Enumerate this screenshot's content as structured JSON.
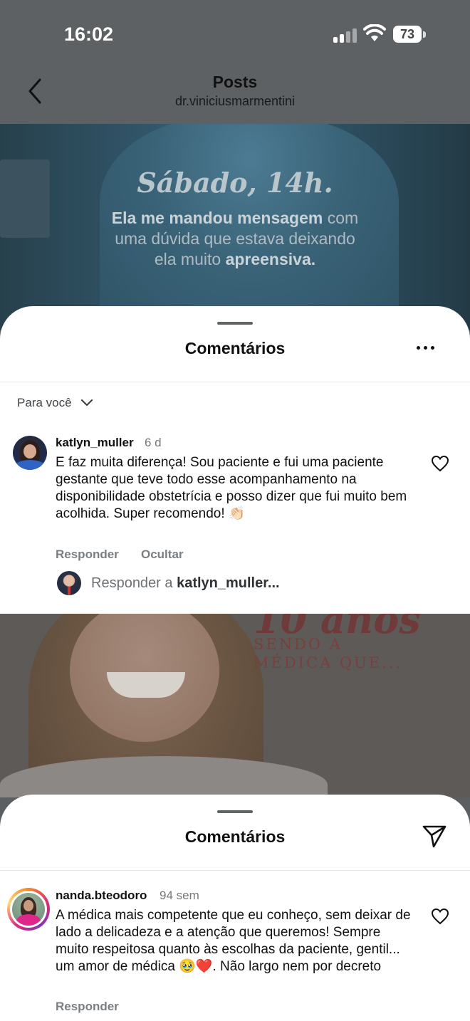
{
  "status_bar": {
    "time": "16:02",
    "battery": "73"
  },
  "header": {
    "title": "Posts",
    "username": "dr.viniciusmarmentini"
  },
  "post1_overlay": {
    "heading": "Sábado, 14h.",
    "line1_bold": "Ela me mandou mensagem",
    "line1_rest": " com",
    "line2": "uma dúvida que estava deixando",
    "line3_start": "ela muito ",
    "line3_bold": "apreensiva."
  },
  "sheet1": {
    "title": "Comentários",
    "filter": "Para você",
    "comment": {
      "username": "katlyn_muller",
      "time": "6 d",
      "text": "E faz muita diferença! Sou paciente e fui uma paciente gestante que teve todo esse acompanhamento na disponibilidade obstetrícia e posso dizer que fui muito bem acolhida. Super recomendo! 👏🏻",
      "reply_label": "Responder",
      "hide_label": "Ocultar"
    },
    "reply_prompt_prefix": "Responder a ",
    "reply_prompt_user": "katlyn_muller..."
  },
  "post2_overlay": {
    "years": "10 anos",
    "sub_line1": "SENDO A",
    "sub_line2": "MÉDICA QUE..."
  },
  "sheet2": {
    "title": "Comentários",
    "comment": {
      "username": "nanda.bteodoro",
      "time": "94 sem",
      "text": "A médica mais competente que eu conheço, sem deixar de lado a delicadeza e a atenção que queremos! Sempre muito respeitosa quanto às escolhas da paciente, gentil... um amor de médica 🥹❤️. Não largo nem por decreto",
      "reply_label": "Responder"
    }
  },
  "colors": {
    "dim_overlay": "#5e6163",
    "secondary_text": "#7b7f82",
    "sheet_bg": "#ffffff"
  }
}
